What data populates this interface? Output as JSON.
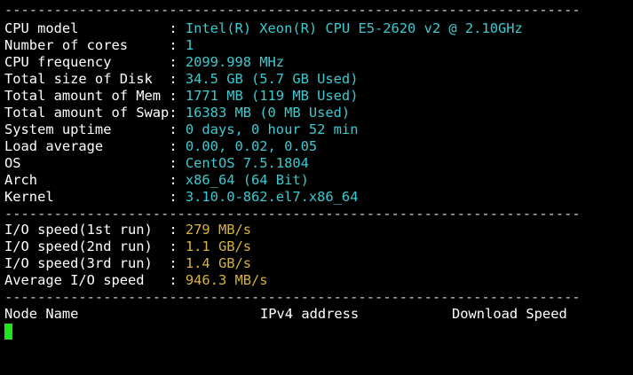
{
  "terminal": {
    "separator": "----------------------------------------------------------------------",
    "system_info": [
      {
        "label": "CPU model           ",
        "value": "Intel(R) Xeon(R) CPU E5-2620 v2 @ 2.10GHz"
      },
      {
        "label": "Number of cores     ",
        "value": "1"
      },
      {
        "label": "CPU frequency       ",
        "value": "2099.998 MHz"
      },
      {
        "label": "Total size of Disk  ",
        "value": "34.5 GB (5.7 GB Used)"
      },
      {
        "label": "Total amount of Mem ",
        "value": "1771 MB (119 MB Used)"
      },
      {
        "label": "Total amount of Swap",
        "value": "16383 MB (0 MB Used)"
      },
      {
        "label": "System uptime       ",
        "value": "0 days, 0 hour 52 min"
      },
      {
        "label": "Load average        ",
        "value": "0.00, 0.02, 0.05"
      },
      {
        "label": "OS                  ",
        "value": "CentOS 7.5.1804"
      },
      {
        "label": "Arch                ",
        "value": "x86_64 (64 Bit)"
      },
      {
        "label": "Kernel              ",
        "value": "3.10.0-862.el7.x86_64"
      }
    ],
    "io_info": [
      {
        "label": "I/O speed(1st run)  ",
        "value": "279 MB/s"
      },
      {
        "label": "I/O speed(2nd run)  ",
        "value": "1.1 GB/s"
      },
      {
        "label": "I/O speed(3rd run)  ",
        "value": "1.4 GB/s"
      },
      {
        "label": "Average I/O speed   ",
        "value": "946.3 MB/s"
      }
    ],
    "colon": ": ",
    "node_header": {
      "node_name": "Node Name",
      "ipv4": "IPv4 address",
      "download": "Download Speed"
    },
    "colors": {
      "background": "#000000",
      "text": "#ffffff",
      "value_cyan": "#3ccad0",
      "value_yellow": "#d8b33a",
      "cursor": "#1ee61e"
    }
  }
}
